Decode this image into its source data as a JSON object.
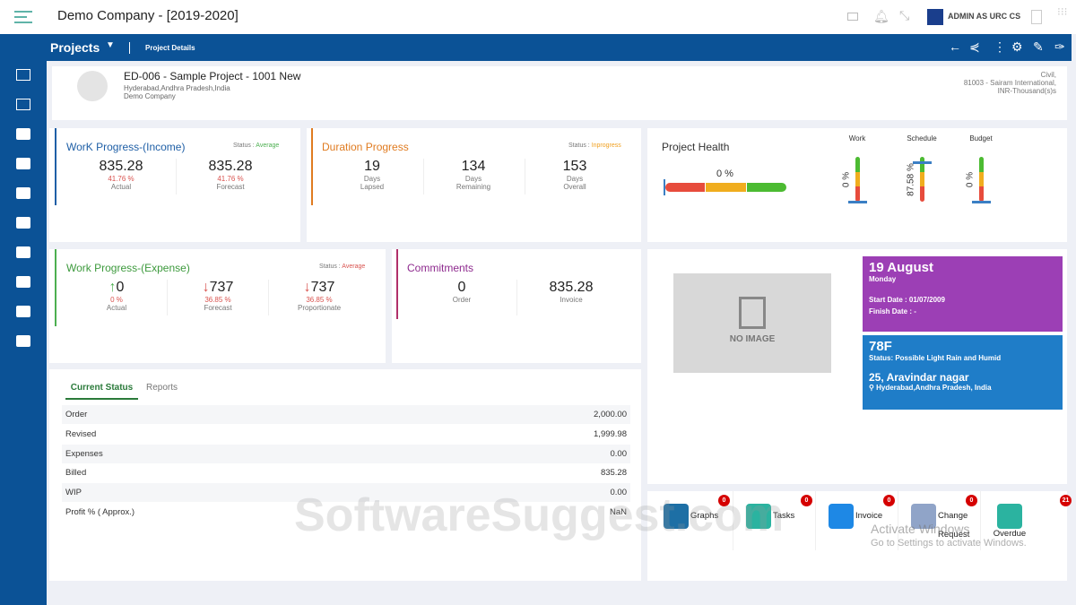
{
  "topbar": {
    "title": "Demo Company - [2019-2020]",
    "user": "ADMIN AS URC CS"
  },
  "header": {
    "module": "Projects",
    "breadcrumb": "Project Details"
  },
  "project": {
    "name": "ED-006 - Sample Project - 1001 New",
    "location": "Hyderabad,Andhra Pradesh,India",
    "company": "Demo Company",
    "type": "Civil,",
    "client": "81003 - Sairam International,",
    "currency": "INR-Thousand(s)s"
  },
  "income": {
    "title": "WorK Progress-(Income)",
    "status_label": "Status :",
    "status": "Average",
    "actual": "835.28",
    "actual_pct": "41.76 %",
    "actual_label": "Actual",
    "forecast": "835.28",
    "forecast_pct": "41.76 %",
    "forecast_label": "Forecast"
  },
  "duration": {
    "title": "Duration Progress",
    "status_label": "Status :",
    "status": "Inprogress",
    "items": [
      {
        "value": "19",
        "l1": "Days",
        "l2": "Lapsed"
      },
      {
        "value": "134",
        "l1": "Days",
        "l2": "Remaining"
      },
      {
        "value": "153",
        "l1": "Days",
        "l2": "Overall"
      }
    ]
  },
  "health": {
    "title": "Project Health",
    "overall": "0 %",
    "overall_value": 0,
    "gauges": [
      {
        "label": "Work",
        "value": "0 %",
        "percent": 0
      },
      {
        "label": "Schedule",
        "value": "87.58 %",
        "percent": 87.58
      },
      {
        "label": "Budget",
        "value": "0 %",
        "percent": 0
      }
    ]
  },
  "expense": {
    "title": "Work Progress-(Expense)",
    "status_label": "Status :",
    "status": "Average",
    "items": [
      {
        "arrow": "↑",
        "value": "0",
        "pct": "0 %",
        "label": "Actual"
      },
      {
        "arrow": "↓",
        "value": "737",
        "pct": "36.85 %",
        "label": "Forecast"
      },
      {
        "arrow": "↓",
        "value": "737",
        "pct": "36.85 %",
        "label": "Proportionate"
      }
    ]
  },
  "commitments": {
    "title": "Commitments",
    "order": "0",
    "order_label": "Order",
    "invoice": "835.28",
    "invoice_label": "Invoice"
  },
  "image": {
    "placeholder": "NO IMAGE"
  },
  "date_card": {
    "date": "19 August",
    "day": "Monday",
    "start": "Start Date : 01/07/2009",
    "finish": "Finish Date : -"
  },
  "weather": {
    "temp": "78F",
    "status": "Status: Possible Light Rain and Humid",
    "address": "25, Aravindar nagar",
    "city": "Hyderabad,Andhra Pradesh, India"
  },
  "tabs": {
    "current": "Current Status",
    "reports": "Reports"
  },
  "status_rows": [
    {
      "label": "Order",
      "value": "2,000.00"
    },
    {
      "label": "Revised",
      "value": "1,999.98"
    },
    {
      "label": "Expenses",
      "value": "0.00"
    },
    {
      "label": "Billed",
      "value": "835.28"
    },
    {
      "label": "WIP",
      "value": "0.00"
    },
    {
      "label": "Profit % ( Approx.)",
      "value": "NaN"
    }
  ],
  "shortcuts": [
    {
      "label": "Graphs",
      "count": "0"
    },
    {
      "label": "Tasks",
      "count": "0"
    },
    {
      "label": "Invoice",
      "count": "0"
    },
    {
      "label": "Change Request",
      "count": "0"
    },
    {
      "label": "Overdue",
      "count": "21"
    }
  ],
  "overlay": {
    "watermark": "SoftwareSuggest.com",
    "activate1": "Activate Windows",
    "activate2": "Go to Settings to activate Windows."
  }
}
